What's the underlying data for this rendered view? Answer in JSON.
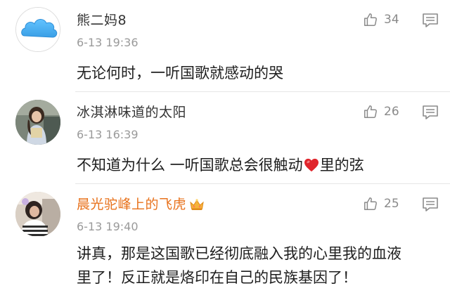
{
  "comments": [
    {
      "avatar": "cloud-avatar",
      "username": "熊二妈8",
      "timestamp": "6-13 19:36",
      "likes": "34",
      "text": "无论何时，一听国歌就感动的哭"
    },
    {
      "avatar": "girl-photo-avatar",
      "username": "冰淇淋味道的太阳",
      "timestamp": "6-13 16:39",
      "likes": "26",
      "text_before": "不知道为什么 一听国歌总会很触动",
      "emoji": "heart-emoji",
      "text_after": "里的弦"
    },
    {
      "avatar": "photo-avatar",
      "username": "晨光驼峰上的飞虎",
      "username_badge": "crown-icon",
      "timestamp": "6-13 19:40",
      "likes": "25",
      "text_lines": [
        "讲真，那是这国歌已经彻底融入我的心里我的血液",
        "里了！反正就是烙印在自己的民族基因了！"
      ]
    }
  ],
  "colors": {
    "vip_username": "#e8721c",
    "username": "#333333",
    "meta": "#9a9a9a",
    "heart": "#e0242b"
  }
}
